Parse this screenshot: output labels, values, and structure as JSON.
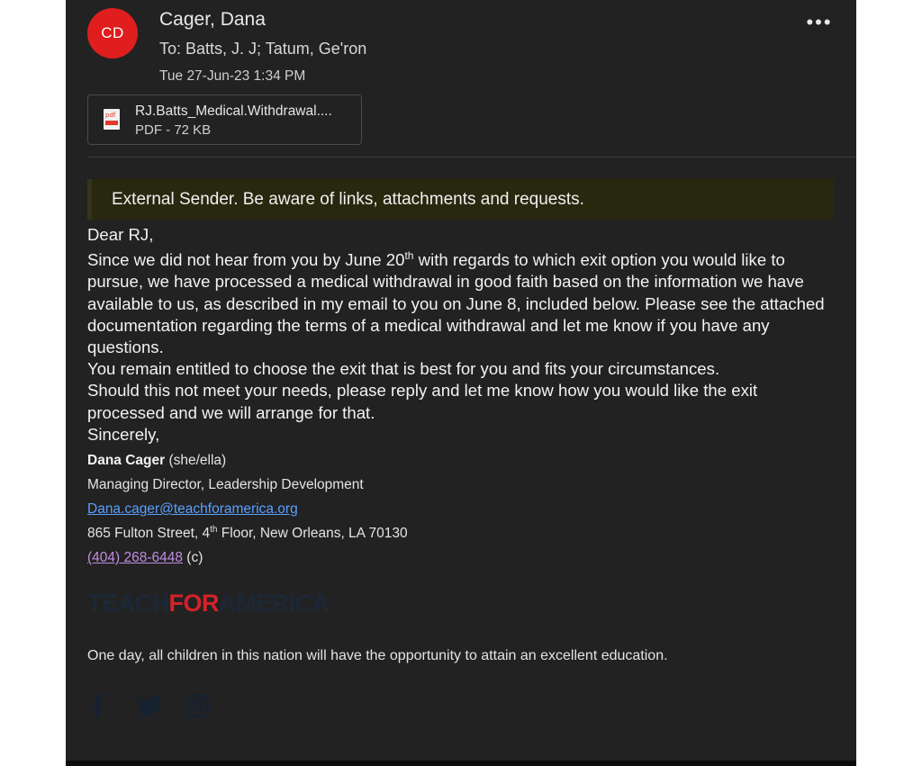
{
  "email": {
    "avatar_initials": "CD",
    "sender": "Cager, Dana",
    "to_label": "To:",
    "recipients": [
      "Batts, J. J;",
      "Tatum, Ge'ron"
    ],
    "date": "Tue 27-Jun-23 1:34 PM",
    "more_label": "•••"
  },
  "attachment": {
    "icon_text": "pdf",
    "name": "RJ.Batts_Medical.Withdrawal....",
    "meta": "PDF - 72 KB"
  },
  "banner": {
    "text": "External Sender. Be aware of links, attachments and requests."
  },
  "body": {
    "greeting": "Dear RJ,",
    "p1_a": "Since we did not hear from you by June 20",
    "p1_sup": "th",
    "p1_b": " with regards to which exit option you would like to pursue, we have processed a medical withdrawal in good faith based on the information we have available to us, as described in my email to you on June 8, included below.  Please see the attached documentation regarding the terms of a medical withdrawal and let me know if you have any questions.",
    "p2": "You remain entitled to choose the exit that is best for you and fits your circumstances.",
    "p3": "Should this not meet your needs, please reply and let me know how you would like the exit processed and we will arrange for that.",
    "closing": "Sincerely,"
  },
  "signature": {
    "name": "Dana Cager",
    "pronouns": " (she/ella)",
    "title": "Managing Director, Leadership Development",
    "email": "Dana.cager@teachforamerica.org",
    "address_a": "865 Fulton Street, 4",
    "address_sup": "th",
    "address_b": " Floor, New Orleans, LA 70130",
    "phone": "(404) 268-6448",
    "phone_suffix": " (c)"
  },
  "logo": {
    "part1": "TEACH",
    "part2": "FOR",
    "part3": "AMERICA",
    "color_dim": "#1c2838",
    "color_red": "#d3222a"
  },
  "mission": "One day, all children in this nation will have the opportunity to attain an excellent education.",
  "social": {
    "icons": [
      "facebook-icon",
      "twitter-icon",
      "instagram-icon"
    ],
    "color": "#162230"
  },
  "colors": {
    "background": "#222222",
    "avatar": "#e01e1e",
    "banner": "#28280f",
    "link": "#5aa0ff",
    "visited_link": "#c08de0"
  }
}
